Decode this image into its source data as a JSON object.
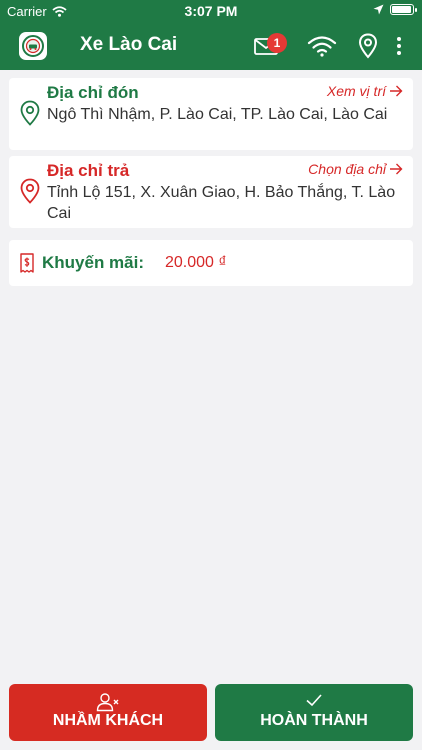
{
  "status_bar": {
    "carrier": "Carrier",
    "time": "3:07 PM",
    "battery_level": 0.95
  },
  "header": {
    "title": "Xe Lào Cai",
    "notification_count": "1",
    "icons": [
      "app-logo-icon",
      "mail-icon",
      "wifi-icon",
      "location-pin-icon",
      "more-vertical-icon"
    ]
  },
  "pickup": {
    "title": "Địa chỉ đón",
    "link_label": "Xem vị trí",
    "address": "Ngô Thì Nhậm, P. Lào Cai, TP. Lào Cai, Lào Cai"
  },
  "dropoff": {
    "title": "Địa chỉ trả",
    "link_label": "Chọn địa chỉ",
    "address": "Tỉnh Lộ 151, X. Xuân Giao, H. Bảo Thắng, T. Lào Cai"
  },
  "promo": {
    "label": "Khuyến mãi:",
    "value": "20.000 ₫"
  },
  "actions": {
    "wrong_customer": "NHẦM KHÁCH",
    "complete": "HOÀN THÀNH"
  },
  "colors": {
    "primary_green": "#1f7a45",
    "accent_red": "#d62828",
    "background": "#f2f2f4"
  }
}
